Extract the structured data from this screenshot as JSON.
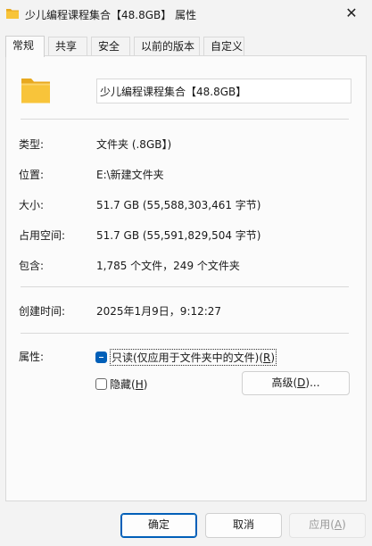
{
  "window": {
    "title": "少儿编程课程集合【48.8GB】 属性",
    "close_glyph": "✕"
  },
  "tabs": [
    {
      "label": "常规",
      "active": true
    },
    {
      "label": "共享"
    },
    {
      "label": "安全"
    },
    {
      "label": "以前的版本"
    },
    {
      "label": "自定义"
    }
  ],
  "general": {
    "folder_icon": "folder-icon",
    "name_value": "少儿编程课程集合【48.8GB】",
    "type_label": "类型:",
    "type_value": "文件夹 (.8GB】)",
    "location_label": "位置:",
    "location_value": "E:\\新建文件夹",
    "size_label": "大小:",
    "size_value": "51.7 GB (55,588,303,461 字节)",
    "size_on_disk_label": "占用空间:",
    "size_on_disk_value": "51.7 GB (55,591,829,504 字节)",
    "contains_label": "包含:",
    "contains_value": "1,785 个文件，249 个文件夹",
    "created_label": "创建时间:",
    "created_value": "2025年1月9日，9:12:27",
    "attributes_label": "属性:",
    "readonly": {
      "before": "只读(仅应用于文件夹中的文件)(",
      "key": "R",
      "after": ")",
      "state": "indeterminate"
    },
    "hidden": {
      "before": "隐藏(",
      "key": "H",
      "after": ")",
      "state": "unchecked"
    },
    "advanced": {
      "before": "高级(",
      "key": "D",
      "after": ")..."
    }
  },
  "buttons": {
    "ok": "确定",
    "cancel": "取消",
    "apply_before": "应用(",
    "apply_key": "A",
    "apply_after": ")"
  },
  "colors": {
    "accent": "#005fb8",
    "folder": "#f8c43a"
  }
}
